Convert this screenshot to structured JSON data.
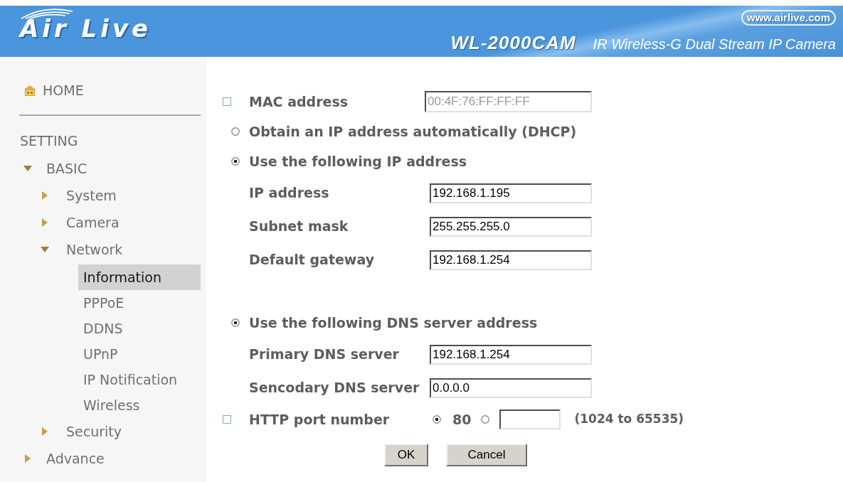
{
  "header": {
    "logo": "Air Live",
    "website": "www.airlive.com",
    "model": "WL-2000CAM",
    "product": "IR Wireless-G Dual Stream IP Camera"
  },
  "sidebar": {
    "home": "HOME",
    "section": "SETTING",
    "tree": [
      {
        "label": "BASIC",
        "expanded": true,
        "children": [
          {
            "label": "System",
            "expanded": false
          },
          {
            "label": "Camera",
            "expanded": false
          },
          {
            "label": "Network",
            "expanded": true,
            "children": [
              {
                "label": "Information",
                "selected": true
              },
              {
                "label": "PPPoE",
                "selected": false
              },
              {
                "label": "DDNS",
                "selected": false
              },
              {
                "label": "UPnP",
                "selected": false
              },
              {
                "label": "IP Notification",
                "selected": false
              },
              {
                "label": "Wireless",
                "selected": false
              }
            ]
          },
          {
            "label": "Security",
            "expanded": false
          }
        ]
      },
      {
        "label": "Advance",
        "expanded": false
      }
    ]
  },
  "form": {
    "mac": {
      "label": "MAC address",
      "checked": false,
      "value": "00:4F:76:FF:FF:FF",
      "disabled": true
    },
    "ip_mode": [
      {
        "label": "Obtain an IP address automatically (DHCP)",
        "selected": false
      },
      {
        "label": "Use the following IP address",
        "selected": true
      }
    ],
    "ip_fields": [
      {
        "label": "IP address",
        "value": "192.168.1.195"
      },
      {
        "label": "Subnet mask",
        "value": "255.255.255.0"
      },
      {
        "label": "Default gateway",
        "value": "192.168.1.254"
      }
    ],
    "dns_mode": {
      "label": "Use the following DNS server address",
      "selected": true
    },
    "dns_fields": [
      {
        "label": "Primary DNS server",
        "value": "192.168.1.254"
      },
      {
        "label": "Sencodary DNS server",
        "value": "0.0.0.0"
      }
    ],
    "http_port": {
      "label": "HTTP port number",
      "checked": false,
      "options": [
        {
          "kind": "preset",
          "label": "80",
          "selected": true
        },
        {
          "kind": "custom",
          "selected": false
        }
      ],
      "range": "(1024 to 65535)"
    },
    "buttons": [
      "OK",
      "Cancel"
    ]
  }
}
